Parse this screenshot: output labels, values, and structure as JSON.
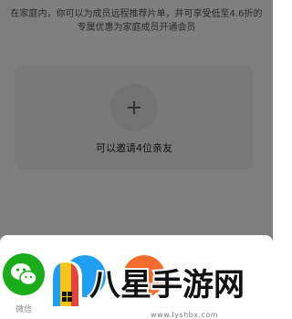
{
  "description": "在家庭内，你可以为成员远程推荐片单，并可享受低至4.6折的专属优惠为家庭成员开通会员",
  "invite_card": {
    "label": "可以邀请4位亲友"
  },
  "share_sheet": {
    "items": [
      {
        "icon": "wechat-icon",
        "label": "微信"
      },
      {
        "icon": "share-blue-icon",
        "label": ""
      },
      {
        "icon": "share-orange-icon",
        "label": ""
      }
    ]
  },
  "watermark": {
    "text": "八星手游网",
    "url": "www.lyshbx.com"
  },
  "colors": {
    "wechat": "#1aad19",
    "blue": "#1e9ff2",
    "orange": "#f46c2b"
  }
}
